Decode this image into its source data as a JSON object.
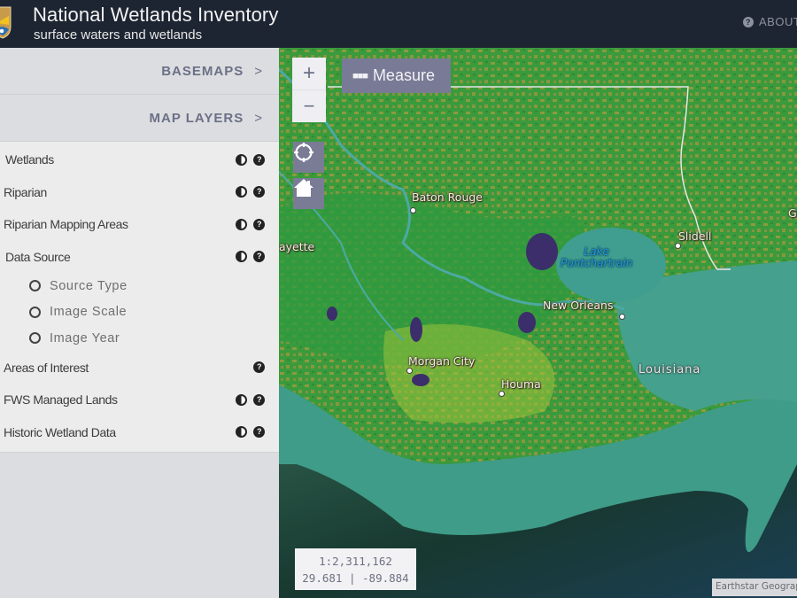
{
  "header": {
    "title": "National Wetlands Inventory",
    "subtitle": "surface waters and wetlands",
    "about_label": "ABOUT",
    "about_icon": "question-circle-icon",
    "logo_icon": "fws-shield-logo"
  },
  "sidebar": {
    "accordions": [
      {
        "label": "BASEMAPS",
        "icon": "chevron-right-icon"
      },
      {
        "label": "MAP LAYERS",
        "icon": "chevron-right-icon"
      }
    ],
    "layers": [
      {
        "label": "Wetlands",
        "icons": [
          "contrast-icon",
          "help-icon"
        ]
      },
      {
        "label": "Riparian",
        "icons": [
          "contrast-icon",
          "help-icon"
        ]
      },
      {
        "label": "Riparian Mapping Areas",
        "icons": [
          "contrast-icon",
          "help-icon"
        ]
      },
      {
        "label": "Data Source",
        "icons": [
          "contrast-icon",
          "help-icon"
        ],
        "options": [
          {
            "label": "Source Type",
            "selected": false
          },
          {
            "label": "Image Scale",
            "selected": false
          },
          {
            "label": "Image Year",
            "selected": false
          }
        ]
      },
      {
        "label": "Areas of Interest",
        "icons": [
          "help-icon"
        ]
      },
      {
        "label": "FWS Managed Lands",
        "icons": [
          "contrast-icon",
          "help-icon"
        ]
      },
      {
        "label": "Historic Wetland Data",
        "icons": [
          "contrast-icon",
          "help-icon"
        ]
      }
    ]
  },
  "map": {
    "zoom_in_label": "+",
    "zoom_out_label": "−",
    "measure_label": "Measure",
    "measure_icon": "ellipsis-icon",
    "locate_icon": "crosshair-icon",
    "home_icon": "home-icon",
    "scale": "1:2,311,162",
    "coordinates": "29.681 | -89.884",
    "attribution": "Earthstar Geographics",
    "labels": {
      "baton_rouge": "Baton Rouge",
      "lafayette": "ayette",
      "slidell": "Slidell",
      "lake_line1": "Lake",
      "lake_line2": "Pontchartrain",
      "new_orleans": "New Orleans",
      "morgan_city": "Morgan City",
      "houma": "Houma",
      "louisiana": "Louisiana",
      "gulfport_partial": "G"
    }
  }
}
